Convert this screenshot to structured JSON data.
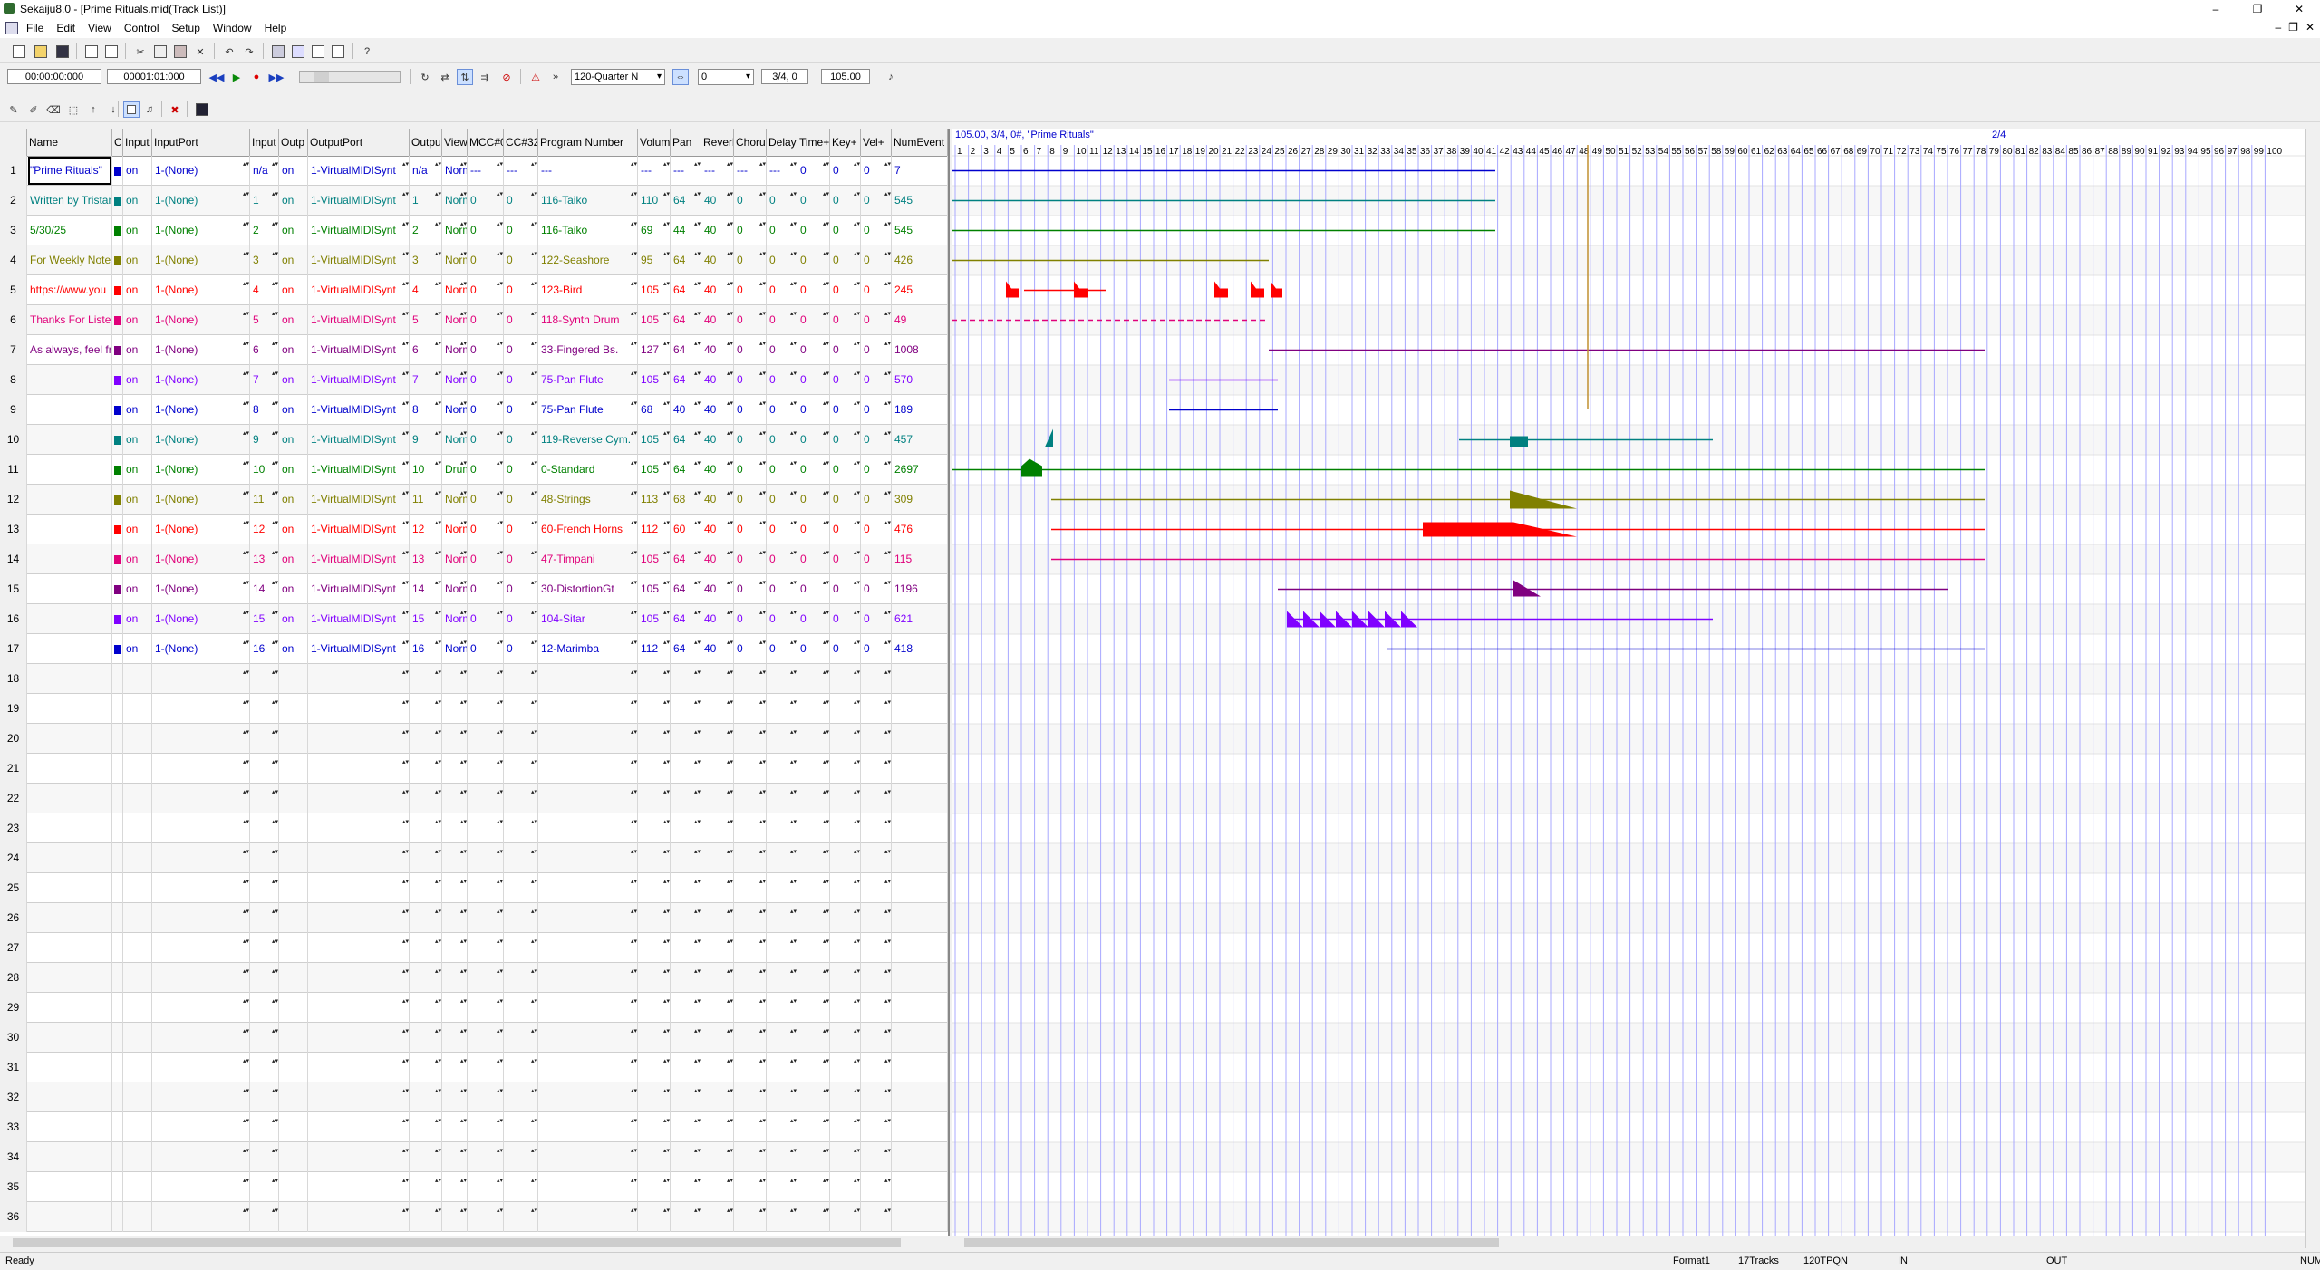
{
  "window": {
    "title": "Sekaiju8.0 - [Prime Rituals.mid(Track List)]",
    "min": "–",
    "max": "❐",
    "close": "✕"
  },
  "menu": [
    "File",
    "Edit",
    "View",
    "Control",
    "Setup",
    "Window",
    "Help"
  ],
  "transport": {
    "time": "00:00:00:000",
    "measure": "00001:01:000",
    "timebase": "120-Quarter N",
    "offset": "0",
    "timesig": "3/4, 0",
    "tempo": "105.00"
  },
  "headers": [
    "Name",
    "C",
    "Input",
    "InputPort",
    "Input",
    "Outp",
    "OutputPort",
    "Outpu",
    "View",
    "MCC#0",
    "CC#32",
    "Program Number",
    "Volum",
    "Pan",
    "Reverb",
    "Chorus",
    "Delay",
    "Time+",
    "Key+",
    "Vel+",
    "NumEvent"
  ],
  "tracks": [
    {
      "n": "1",
      "name": "\"Prime Rituals\"",
      "color": "#0000cc",
      "input": "on",
      "inport": "1-(None)",
      "inch": "n/a",
      "output": "on",
      "outport": "1-VirtualMIDISynt",
      "outch": "n/a",
      "view": "Norma",
      "cc0": "---",
      "cc32": "---",
      "prog": "---",
      "vol": "---",
      "pan": "---",
      "rev": "---",
      "cho": "---",
      "del": "---",
      "time": "0",
      "key": "0",
      "vel": "0",
      "events": "7"
    },
    {
      "n": "2",
      "name": "Written by Tristan",
      "color": "#008080",
      "input": "on",
      "inport": "1-(None)",
      "inch": "1",
      "output": "on",
      "outport": "1-VirtualMIDISynt",
      "outch": "1",
      "view": "Norma",
      "cc0": "0",
      "cc32": "0",
      "prog": "116-Taiko",
      "vol": "110",
      "pan": "64",
      "rev": "40",
      "cho": "0",
      "del": "0",
      "time": "0",
      "key": "0",
      "vel": "0",
      "events": "545"
    },
    {
      "n": "3",
      "name": "5/30/25",
      "color": "#008000",
      "input": "on",
      "inport": "1-(None)",
      "inch": "2",
      "output": "on",
      "outport": "1-VirtualMIDISynt",
      "outch": "2",
      "view": "Norma",
      "cc0": "0",
      "cc32": "0",
      "prog": "116-Taiko",
      "vol": "69",
      "pan": "44",
      "rev": "40",
      "cho": "0",
      "del": "0",
      "time": "0",
      "key": "0",
      "vel": "0",
      "events": "545"
    },
    {
      "n": "4",
      "name": "For Weekly Note",
      "color": "#808000",
      "input": "on",
      "inport": "1-(None)",
      "inch": "3",
      "output": "on",
      "outport": "1-VirtualMIDISynt",
      "outch": "3",
      "view": "Norma",
      "cc0": "0",
      "cc32": "0",
      "prog": "122-Seashore",
      "vol": "95",
      "pan": "64",
      "rev": "40",
      "cho": "0",
      "del": "0",
      "time": "0",
      "key": "0",
      "vel": "0",
      "events": "426"
    },
    {
      "n": "5",
      "name": "https://www.you",
      "color": "#ff0000",
      "input": "on",
      "inport": "1-(None)",
      "inch": "4",
      "output": "on",
      "outport": "1-VirtualMIDISynt",
      "outch": "4",
      "view": "Norma",
      "cc0": "0",
      "cc32": "0",
      "prog": "123-Bird",
      "vol": "105",
      "pan": "64",
      "rev": "40",
      "cho": "0",
      "del": "0",
      "time": "0",
      "key": "0",
      "vel": "0",
      "events": "245"
    },
    {
      "n": "6",
      "name": "Thanks For Listen",
      "color": "#e0007a",
      "input": "on",
      "inport": "1-(None)",
      "inch": "5",
      "output": "on",
      "outport": "1-VirtualMIDISynt",
      "outch": "5",
      "view": "Norma",
      "cc0": "0",
      "cc32": "0",
      "prog": "118-Synth Drum",
      "vol": "105",
      "pan": "64",
      "rev": "40",
      "cho": "0",
      "del": "0",
      "time": "0",
      "key": "0",
      "vel": "0",
      "events": "49"
    },
    {
      "n": "7",
      "name": "As always, feel fre",
      "color": "#800080",
      "input": "on",
      "inport": "1-(None)",
      "inch": "6",
      "output": "on",
      "outport": "1-VirtualMIDISynt",
      "outch": "6",
      "view": "Norma",
      "cc0": "0",
      "cc32": "0",
      "prog": "33-Fingered Bs.",
      "vol": "127",
      "pan": "64",
      "rev": "40",
      "cho": "0",
      "del": "0",
      "time": "0",
      "key": "0",
      "vel": "0",
      "events": "1008"
    },
    {
      "n": "8",
      "name": "",
      "color": "#8000ff",
      "input": "on",
      "inport": "1-(None)",
      "inch": "7",
      "output": "on",
      "outport": "1-VirtualMIDISynt",
      "outch": "7",
      "view": "Norma",
      "cc0": "0",
      "cc32": "0",
      "prog": "75-Pan Flute",
      "vol": "105",
      "pan": "64",
      "rev": "40",
      "cho": "0",
      "del": "0",
      "time": "0",
      "key": "0",
      "vel": "0",
      "events": "570"
    },
    {
      "n": "9",
      "name": "",
      "color": "#0000cc",
      "input": "on",
      "inport": "1-(None)",
      "inch": "8",
      "output": "on",
      "outport": "1-VirtualMIDISynt",
      "outch": "8",
      "view": "Norma",
      "cc0": "0",
      "cc32": "0",
      "prog": "75-Pan Flute",
      "vol": "68",
      "pan": "40",
      "rev": "40",
      "cho": "0",
      "del": "0",
      "time": "0",
      "key": "0",
      "vel": "0",
      "events": "189"
    },
    {
      "n": "10",
      "name": "",
      "color": "#008080",
      "input": "on",
      "inport": "1-(None)",
      "inch": "9",
      "output": "on",
      "outport": "1-VirtualMIDISynt",
      "outch": "9",
      "view": "Norma",
      "cc0": "0",
      "cc32": "0",
      "prog": "119-Reverse Cym.",
      "vol": "105",
      "pan": "64",
      "rev": "40",
      "cho": "0",
      "del": "0",
      "time": "0",
      "key": "0",
      "vel": "0",
      "events": "457"
    },
    {
      "n": "11",
      "name": "",
      "color": "#008000",
      "input": "on",
      "inport": "1-(None)",
      "inch": "10",
      "output": "on",
      "outport": "1-VirtualMIDISynt",
      "outch": "10",
      "view": "Drum",
      "cc0": "0",
      "cc32": "0",
      "prog": "0-Standard",
      "vol": "105",
      "pan": "64",
      "rev": "40",
      "cho": "0",
      "del": "0",
      "time": "0",
      "key": "0",
      "vel": "0",
      "events": "2697"
    },
    {
      "n": "12",
      "name": "",
      "color": "#808000",
      "input": "on",
      "inport": "1-(None)",
      "inch": "11",
      "output": "on",
      "outport": "1-VirtualMIDISynt",
      "outch": "11",
      "view": "Norma",
      "cc0": "0",
      "cc32": "0",
      "prog": "48-Strings",
      "vol": "113",
      "pan": "68",
      "rev": "40",
      "cho": "0",
      "del": "0",
      "time": "0",
      "key": "0",
      "vel": "0",
      "events": "309"
    },
    {
      "n": "13",
      "name": "",
      "color": "#ff0000",
      "input": "on",
      "inport": "1-(None)",
      "inch": "12",
      "output": "on",
      "outport": "1-VirtualMIDISynt",
      "outch": "12",
      "view": "Norma",
      "cc0": "0",
      "cc32": "0",
      "prog": "60-French Horns",
      "vol": "112",
      "pan": "60",
      "rev": "40",
      "cho": "0",
      "del": "0",
      "time": "0",
      "key": "0",
      "vel": "0",
      "events": "476"
    },
    {
      "n": "14",
      "name": "",
      "color": "#e0007a",
      "input": "on",
      "inport": "1-(None)",
      "inch": "13",
      "output": "on",
      "outport": "1-VirtualMIDISynt",
      "outch": "13",
      "view": "Norma",
      "cc0": "0",
      "cc32": "0",
      "prog": "47-Timpani",
      "vol": "105",
      "pan": "64",
      "rev": "40",
      "cho": "0",
      "del": "0",
      "time": "0",
      "key": "0",
      "vel": "0",
      "events": "115"
    },
    {
      "n": "15",
      "name": "",
      "color": "#800080",
      "input": "on",
      "inport": "1-(None)",
      "inch": "14",
      "output": "on",
      "outport": "1-VirtualMIDISynt",
      "outch": "14",
      "view": "Norma",
      "cc0": "0",
      "cc32": "0",
      "prog": "30-DistortionGt",
      "vol": "105",
      "pan": "64",
      "rev": "40",
      "cho": "0",
      "del": "0",
      "time": "0",
      "key": "0",
      "vel": "0",
      "events": "1196"
    },
    {
      "n": "16",
      "name": "",
      "color": "#8000ff",
      "input": "on",
      "inport": "1-(None)",
      "inch": "15",
      "output": "on",
      "outport": "1-VirtualMIDISynt",
      "outch": "15",
      "view": "Norma",
      "cc0": "0",
      "cc32": "0",
      "prog": "104-Sitar",
      "vol": "105",
      "pan": "64",
      "rev": "40",
      "cho": "0",
      "del": "0",
      "time": "0",
      "key": "0",
      "vel": "0",
      "events": "621"
    },
    {
      "n": "17",
      "name": "",
      "color": "#0000cc",
      "input": "on",
      "inport": "1-(None)",
      "inch": "16",
      "output": "on",
      "outport": "1-VirtualMIDISynt",
      "outch": "16",
      "view": "Norma",
      "cc0": "0",
      "cc32": "0",
      "prog": "12-Marimba",
      "vol": "112",
      "pan": "64",
      "rev": "40",
      "cho": "0",
      "del": "0",
      "time": "0",
      "key": "0",
      "vel": "0",
      "events": "418"
    }
  ],
  "empty_rows": [
    "18",
    "19",
    "20",
    "21",
    "22",
    "23",
    "24",
    "25",
    "26",
    "27",
    "28",
    "29",
    "30",
    "31",
    "32",
    "33",
    "34",
    "35",
    "36"
  ],
  "roll": {
    "meta_left": "105.00, 3/4, 0#, \"Prime Rituals\"",
    "meta_right": "2/4"
  },
  "status": {
    "ready": "Ready",
    "format": "Format1",
    "tracks": "17Tracks",
    "tpqn": "120TPQN",
    "in": "IN",
    "out": "OUT",
    "num": "NUM"
  }
}
